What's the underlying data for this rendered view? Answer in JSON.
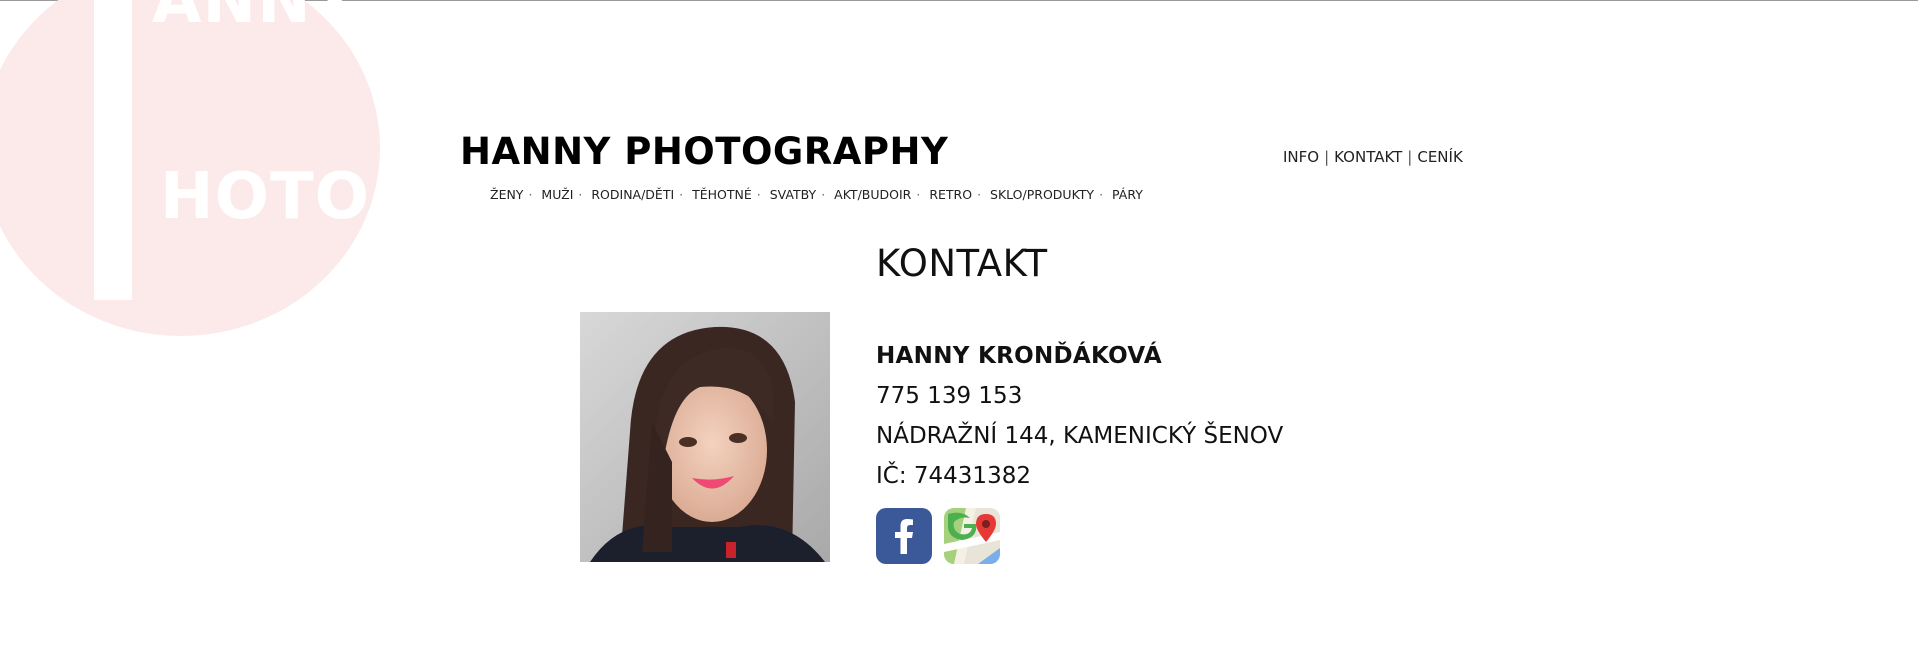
{
  "logo": {
    "big_letters": "HP",
    "text_top": "ANNY",
    "text_bottom": "HOTO"
  },
  "site_title": "HANNY PHOTOGRAPHY",
  "categories": [
    "ŽENY",
    "MUŽI",
    "RODINA/DĚTI",
    "TĚHOTNÉ",
    "SVATBY",
    "AKT/BUDOIR",
    "RETRO",
    "SKLO/PRODUKTY",
    "PÁRY"
  ],
  "category_separator": "·",
  "top_nav": {
    "info": "INFO",
    "kontakt": "KONTAKT",
    "cenik": "CENÍK",
    "separator": "|"
  },
  "contact": {
    "heading": "KONTAKT",
    "name": "HANNY KRONĎÁKOVÁ",
    "phone": "775 139 153",
    "address": "NÁDRAŽNÍ 144, KAMENICKÝ ŠENOV",
    "ic": "IČ: 74431382"
  },
  "social": {
    "facebook_icon": "facebook-icon",
    "maps_icon": "google-maps-icon"
  },
  "colors": {
    "facebook": "#3b5998",
    "logo_pink": "#fceaea",
    "text": "#111111"
  }
}
